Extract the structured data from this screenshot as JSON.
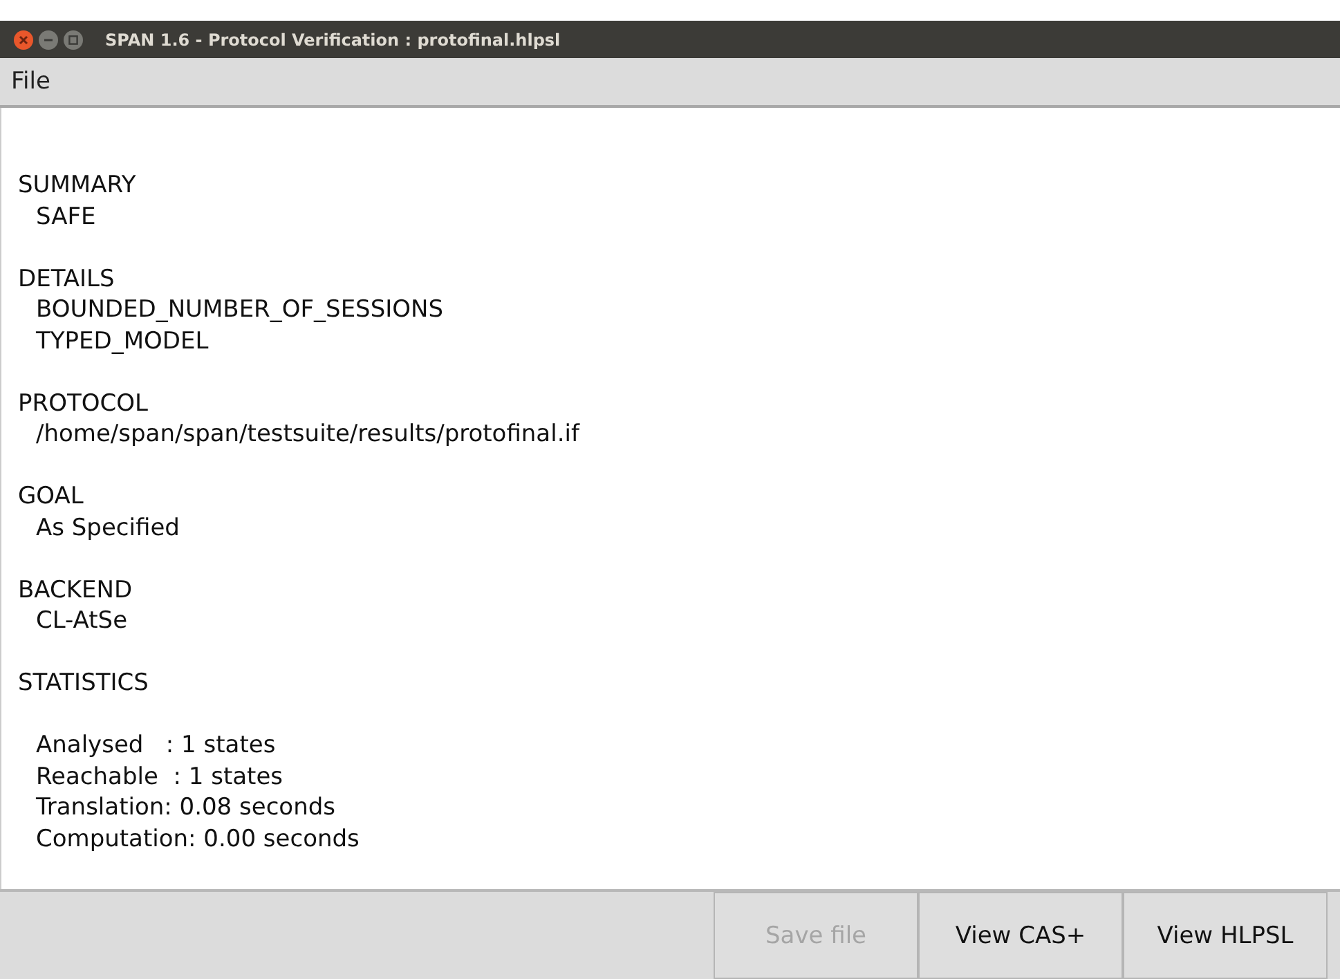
{
  "window": {
    "title": "SPAN 1.6 - Protocol Verification : protofinal.hlpsl"
  },
  "menu": [
    "File"
  ],
  "sections": [
    {
      "kind": "list",
      "heading": "SUMMARY",
      "lines": [
        "SAFE"
      ]
    },
    {
      "kind": "list",
      "heading": "DETAILS",
      "lines": [
        "BOUNDED_NUMBER_OF_SESSIONS",
        "TYPED_MODEL"
      ]
    },
    {
      "kind": "list",
      "heading": "PROTOCOL",
      "lines": [
        "/home/span/span/testsuite/results/protofinal.if"
      ]
    },
    {
      "kind": "list",
      "heading": "GOAL",
      "lines": [
        "As Specified"
      ]
    },
    {
      "kind": "list",
      "heading": "BACKEND",
      "lines": [
        "CL-AtSe"
      ]
    },
    {
      "kind": "stats",
      "heading": "STATISTICS",
      "lines": [
        "Analysed   : 1 states",
        "Reachable  : 1 states",
        "Translation: 0.08 seconds",
        "Computation: 0.00 seconds"
      ]
    }
  ],
  "buttons": [
    {
      "label": "Save file",
      "disabled": true
    },
    {
      "label": "View CAS+",
      "disabled": false
    },
    {
      "label": "View HLPSL",
      "disabled": false
    }
  ]
}
